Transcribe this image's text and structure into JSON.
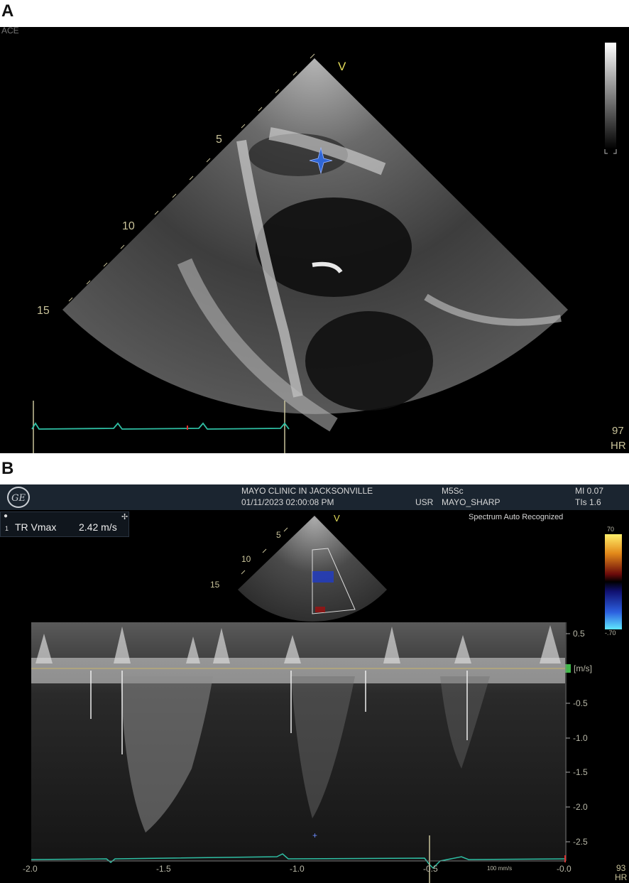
{
  "panel_a": {
    "letter": "A",
    "corner_label": "ACE",
    "orientation_marker": "V",
    "depth_labels": [
      "5",
      "10",
      "15"
    ],
    "hr_value": "97",
    "hr_label": "HR",
    "colors": {
      "ecg": "#2fbfa4",
      "label": "#c9c39a",
      "star": "#2f66d6"
    }
  },
  "panel_b": {
    "letter": "B",
    "header": {
      "institution": "MAYO CLINIC IN JACKSONVILLE",
      "datetime": "01/11/2023 02:00:08 PM",
      "probe": "M5Sc",
      "usr": "USR",
      "preset": "MAYO_SHARP",
      "mi": "MI 0.07",
      "tis": "TIs 1.6",
      "logo": "GE"
    },
    "status": "Spectrum Auto Recognized",
    "measurement": {
      "index": "1",
      "name": "TR Vmax",
      "value": "2.42 m/s"
    },
    "orientation_marker": "V",
    "depth_labels": [
      "5",
      "10",
      "15"
    ],
    "color_scale": {
      "top": "70",
      "bottom": "-.70"
    },
    "velocity_axis": {
      "unit": "[m/s]",
      "ticks": [
        "0.5",
        "-0.5",
        "-1.0",
        "-1.5",
        "-2.0",
        "-2.5"
      ]
    },
    "time_axis": {
      "ticks": [
        "-2.0",
        "-1.5",
        "-1.0",
        "-0.5",
        "-0.0"
      ],
      "sweep": "100 mm/s"
    },
    "hr_value": "93",
    "hr_label": "HR",
    "colors": {
      "ecg": "#2fbfa4",
      "baseline": "#c9b46a",
      "marker": "#41b84a"
    }
  }
}
